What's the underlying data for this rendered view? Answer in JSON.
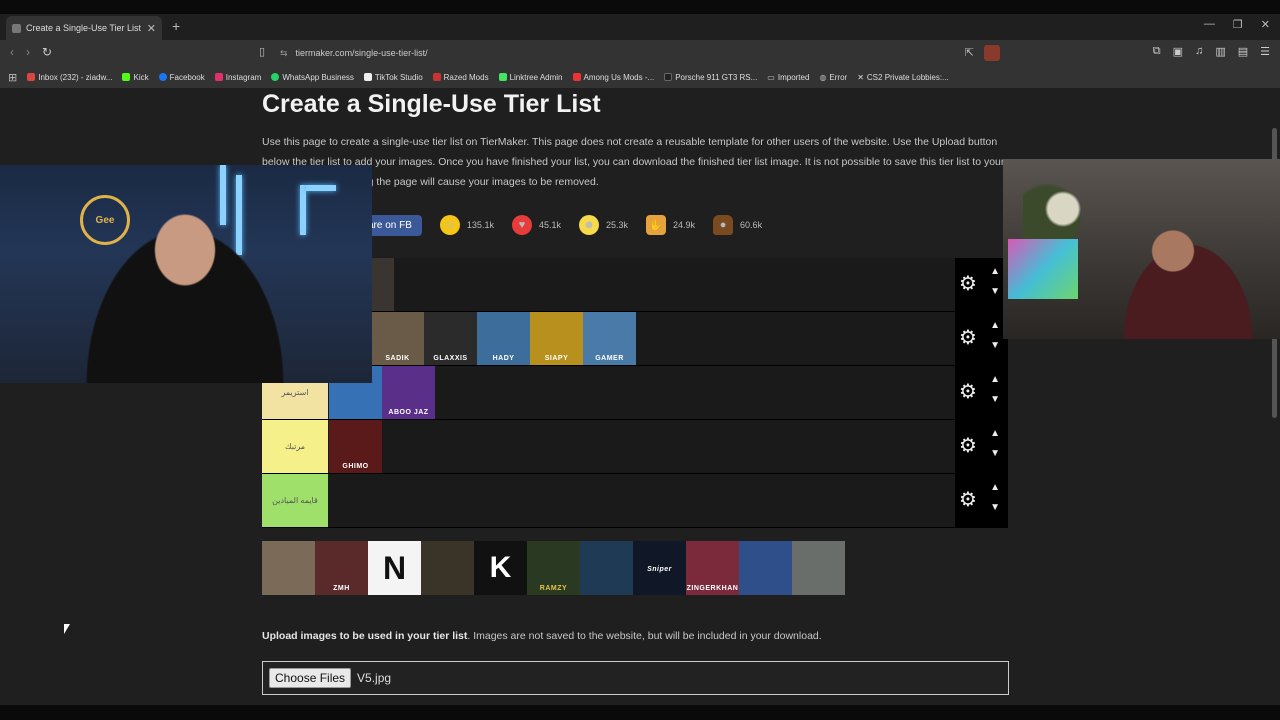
{
  "browser": {
    "tab_title": "Create a Single-Use Tier List (Ph",
    "tab_close": "✕",
    "new_tab": "+",
    "url": "tiermaker.com/single-use-tier-list/",
    "bookmarks": [
      {
        "label": "Inbox (232) - ziadw...",
        "color": "#d44"
      },
      {
        "label": "Kick",
        "color": "#53fc18"
      },
      {
        "label": "Facebook",
        "color": "#1877f2"
      },
      {
        "label": "Instagram",
        "color": "#e1306c"
      },
      {
        "label": "WhatsApp Business",
        "color": "#25d366"
      },
      {
        "label": "TikTok Studio",
        "color": "#eee"
      },
      {
        "label": "Razed Mods",
        "color": "#c33"
      },
      {
        "label": "Linktree Admin",
        "color": "#43e660"
      },
      {
        "label": "Among Us Mods -...",
        "color": "#e33"
      },
      {
        "label": "Porsche 911 GT3 RS...",
        "color": "#222"
      },
      {
        "label": "Imported",
        "color": "#888"
      },
      {
        "label": "Error",
        "color": "#888"
      },
      {
        "label": "CS2 Private Lobbies:...",
        "color": "#ddd"
      }
    ]
  },
  "page": {
    "title": "Create a Single-Use Tier List",
    "description": "Use this page to create a single-use tier list on TierMaker. This page does not create a reusable template for other users of the website. Use the Upload button below the tier list to add your images. Once you have finished your list, you can download the finished tier list image. It is not possible to save this tier list to your profile page. Refreshing the page will cause your images to be removed.",
    "share_fb": "are on FB",
    "reactions": [
      {
        "name": "smile",
        "count": "135.1k"
      },
      {
        "name": "love",
        "count": "45.1k"
      },
      {
        "name": "laugh",
        "count": "25.3k"
      },
      {
        "name": "hands",
        "count": "24.9k"
      },
      {
        "name": "poo",
        "count": "60.6k"
      }
    ]
  },
  "tiers": [
    {
      "label": "",
      "color": "#1a1a1a",
      "items": [
        {
          "text": "",
          "bg": "#5a1a1a"
        },
        {
          "text": "",
          "bg": "#3a3530"
        }
      ]
    },
    {
      "label": "",
      "color": "#1a1a1a",
      "items": [
        {
          "text": "SADIK",
          "bg": "#6a5a48"
        },
        {
          "text": "GLAXXIS",
          "bg": "#2b2b2b"
        },
        {
          "text": "HADY",
          "bg": "#3d6d9a"
        },
        {
          "text": "SIAPY",
          "bg": "#b8901e"
        },
        {
          "text": "GAMER",
          "bg": "#4a7aa8"
        }
      ]
    },
    {
      "label": "استريمر",
      "color": "#f3e3a3",
      "items": [
        {
          "text": "",
          "bg": "#3670b5"
        },
        {
          "text": "ABOO JAZ",
          "bg": "#5a2f8a"
        }
      ]
    },
    {
      "label": "مرتبك",
      "color": "#f5f08a",
      "items": [
        {
          "text": "GHIMO",
          "bg": "#5a1a1a"
        }
      ]
    },
    {
      "label": "قايمه الميادين",
      "color": "#9ee06a",
      "items": []
    }
  ],
  "pool": [
    {
      "text": "",
      "bg": "#7c6a58"
    },
    {
      "text": "ZMH",
      "bg": "#5a2a2a"
    },
    {
      "text": "N",
      "bg": "#f4f4f4"
    },
    {
      "text": "",
      "bg": "#3a3428"
    },
    {
      "text": "K",
      "bg": "#111111"
    },
    {
      "text": "RAMZY",
      "bg": "#2a3a22"
    },
    {
      "text": "",
      "bg": "#1f3a55"
    },
    {
      "text": "Sniper",
      "bg": "#101828"
    },
    {
      "text": "ZINGERKHAN",
      "bg": "#7a2a3a"
    },
    {
      "text": "",
      "bg": "#2f4f8a"
    },
    {
      "text": "",
      "bg": "#6a6e6a"
    }
  ],
  "upload": {
    "bold": "Upload images to be used in your tier list",
    "rest": ". Images are not saved to the website, but will be included in your download.",
    "button": "Choose Files",
    "filename": "V5.jpg"
  },
  "webcam": {
    "logo": "Gee"
  }
}
